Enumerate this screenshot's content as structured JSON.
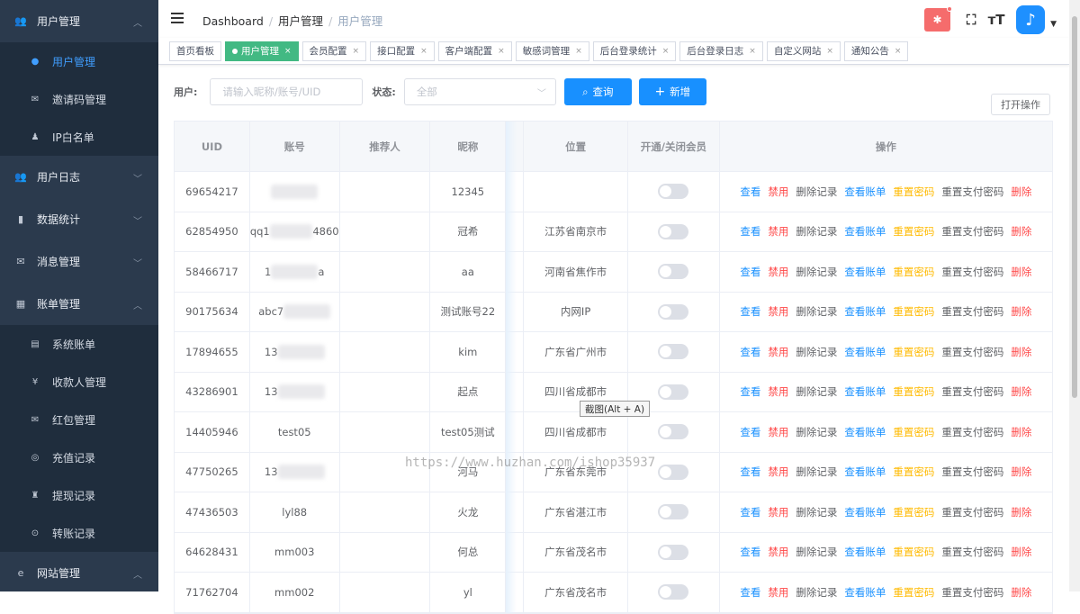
{
  "sidebar": {
    "items": [
      {
        "label": "用户管理",
        "icon": "user-group-icon",
        "type": "parent",
        "arrow": "︿"
      },
      {
        "label": "用户管理",
        "icon": "user-icon",
        "type": "sub",
        "active": true
      },
      {
        "label": "邀请码管理",
        "icon": "invite-icon",
        "type": "sub"
      },
      {
        "label": "IP白名单",
        "icon": "ip-user-icon",
        "type": "sub"
      },
      {
        "label": "用户日志",
        "icon": "user-log-icon",
        "type": "parent",
        "arrow": "﹀"
      },
      {
        "label": "数据统计",
        "icon": "bar-chart-icon",
        "type": "parent",
        "arrow": "﹀"
      },
      {
        "label": "消息管理",
        "icon": "mail-icon",
        "type": "parent",
        "arrow": "﹀"
      },
      {
        "label": "账单管理",
        "icon": "grid-icon",
        "type": "parent",
        "arrow": "︿"
      },
      {
        "label": "系统账单",
        "icon": "bill-icon",
        "type": "sub"
      },
      {
        "label": "收款人管理",
        "icon": "yen-icon",
        "type": "sub"
      },
      {
        "label": "红包管理",
        "icon": "red-packet-icon",
        "type": "sub"
      },
      {
        "label": "充值记录",
        "icon": "recharge-icon",
        "type": "sub"
      },
      {
        "label": "提现记录",
        "icon": "withdraw-icon",
        "type": "sub"
      },
      {
        "label": "转账记录",
        "icon": "transfer-icon",
        "type": "sub"
      },
      {
        "label": "网站管理",
        "icon": "ie-icon",
        "type": "parent",
        "arrow": "︿"
      }
    ]
  },
  "navbar": {
    "breadcrumb": [
      "Dashboard",
      "用户管理",
      "用户管理"
    ]
  },
  "tags": [
    {
      "label": "首页看板",
      "closable": false,
      "active": false
    },
    {
      "label": "用户管理",
      "closable": true,
      "active": true
    },
    {
      "label": "会员配置",
      "closable": true,
      "active": false
    },
    {
      "label": "接口配置",
      "closable": true,
      "active": false
    },
    {
      "label": "客户端配置",
      "closable": true,
      "active": false
    },
    {
      "label": "敏感词管理",
      "closable": true,
      "active": false
    },
    {
      "label": "后台登录统计",
      "closable": true,
      "active": false
    },
    {
      "label": "后台登录日志",
      "closable": true,
      "active": false
    },
    {
      "label": "自定义网站",
      "closable": true,
      "active": false
    },
    {
      "label": "通知公告",
      "closable": true,
      "active": false
    }
  ],
  "search": {
    "user_label": "用户:",
    "user_placeholder": "请输入昵称/账号/UID",
    "status_label": "状态:",
    "status_value": "全部",
    "query_label": "查询",
    "add_label": "新增",
    "open_ops_label": "打开操作"
  },
  "table": {
    "headers": [
      "UID",
      "账号",
      "推荐人",
      "昵称",
      "",
      "位置",
      "开通/关闭会员",
      "操作"
    ],
    "ops": [
      {
        "label": "查看",
        "color": "blue"
      },
      {
        "label": "禁用",
        "color": "red"
      },
      {
        "label": "删除记录",
        "color": "gray"
      },
      {
        "label": "查看账单",
        "color": "blue"
      },
      {
        "label": "重置密码",
        "color": "orange"
      },
      {
        "label": "重置支付密码",
        "color": "gray"
      },
      {
        "label": "删除",
        "color": "red"
      }
    ],
    "rows": [
      {
        "uid": "69654217",
        "account_pre": "",
        "account_post": "",
        "nickname": "12345",
        "location": ""
      },
      {
        "uid": "62854950",
        "account_pre": "qq1",
        "account_post": "4860",
        "nickname": "冠希",
        "location": "江苏省南京市"
      },
      {
        "uid": "58466717",
        "account_pre": "1",
        "account_post": "a",
        "nickname": "aa",
        "location": "河南省焦作市"
      },
      {
        "uid": "90175634",
        "account_pre": "abc7",
        "account_post": "",
        "nickname": "测试账号22",
        "location": "内网IP"
      },
      {
        "uid": "17894655",
        "account_pre": "13",
        "account_post": "",
        "nickname": "kim",
        "location": "广东省广州市"
      },
      {
        "uid": "43286901",
        "account_pre": "13",
        "account_post": "",
        "nickname": "起点",
        "location": "四川省成都市"
      },
      {
        "uid": "14405946",
        "account_pre": "test05",
        "account_post": "",
        "nickname": "test05测试",
        "location": "四川省成都市"
      },
      {
        "uid": "47750265",
        "account_pre": "13",
        "account_post": "",
        "nickname": "河马",
        "location": "广东省东莞市"
      },
      {
        "uid": "47436503",
        "account_pre": "lyl88",
        "account_post": "",
        "nickname": "火龙",
        "location": "广东省湛江市"
      },
      {
        "uid": "64628431",
        "account_pre": "mm003",
        "account_post": "",
        "nickname": "何总",
        "location": "广东省茂名市"
      },
      {
        "uid": "71762704",
        "account_pre": "mm002",
        "account_post": "",
        "nickname": "yl",
        "location": "广东省茂名市"
      }
    ]
  },
  "tooltip": "截图(Alt + A)",
  "watermark": "https://www.huzhan.com/ishop35937"
}
